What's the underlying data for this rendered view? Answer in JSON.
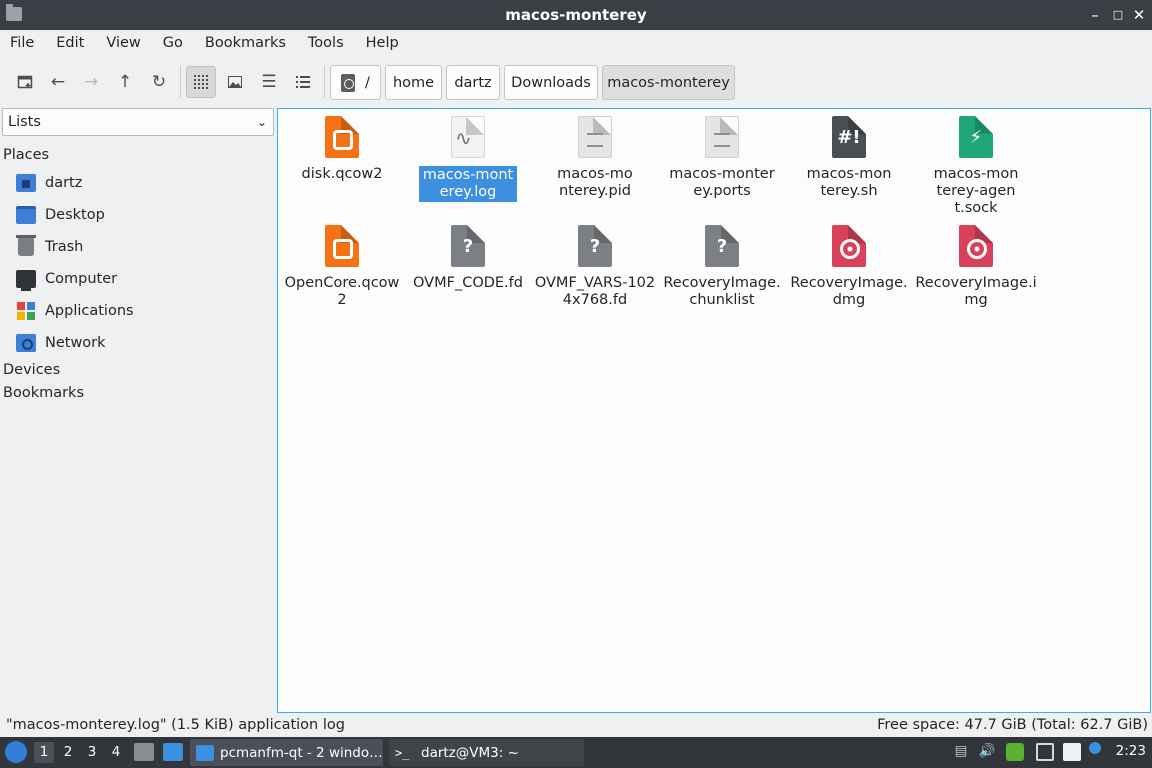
{
  "window": {
    "title": "macos-monterey"
  },
  "menubar": {
    "items": [
      "File",
      "Edit",
      "View",
      "Go",
      "Bookmarks",
      "Tools",
      "Help"
    ]
  },
  "toolbar": {
    "new_window_icon": "new-window-icon",
    "back_icon": "arrow-left-icon",
    "forward_icon": "arrow-right-icon",
    "up_icon": "arrow-up-icon",
    "reload_icon": "reload-icon",
    "view_modes": [
      "icon-view-icon",
      "thumbnail-view-icon",
      "compact-view-icon",
      "detailed-list-view-icon"
    ]
  },
  "breadcrumb": {
    "root_label": "/",
    "segments": [
      "home",
      "dartz",
      "Downloads",
      "macos-monterey"
    ]
  },
  "sidebar": {
    "mode_select": "Lists",
    "places_heading": "Places",
    "places": [
      {
        "label": "dartz",
        "icon": "home-folder-icon"
      },
      {
        "label": "Desktop",
        "icon": "desktop-icon"
      },
      {
        "label": "Trash",
        "icon": "trash-icon"
      },
      {
        "label": "Computer",
        "icon": "computer-icon"
      },
      {
        "label": "Applications",
        "icon": "applications-icon"
      },
      {
        "label": "Network",
        "icon": "network-icon"
      }
    ],
    "devices_heading": "Devices",
    "bookmarks_heading": "Bookmarks"
  },
  "files": [
    {
      "name": "disk.qcow2",
      "icon": "disk-image-icon"
    },
    {
      "name": "macos-monterey.log",
      "icon": "log-file-icon",
      "selected": true
    },
    {
      "name": "macos-monterey.pid",
      "icon": "text-file-icon"
    },
    {
      "name": "macos-monterey.ports",
      "icon": "text-file-icon"
    },
    {
      "name": "macos-monterey.sh",
      "icon": "shell-script-icon"
    },
    {
      "name": "macos-monterey-agent.sock",
      "icon": "socket-file-icon"
    },
    {
      "name": "OpenCore.qcow2",
      "icon": "disk-image-icon"
    },
    {
      "name": "OVMF_CODE.fd",
      "icon": "unknown-file-icon"
    },
    {
      "name": "OVMF_VARS-1024x768.fd",
      "icon": "unknown-file-icon"
    },
    {
      "name": "RecoveryImage.chunklist",
      "icon": "unknown-file-icon"
    },
    {
      "name": "RecoveryImage.dmg",
      "icon": "optical-disc-image-icon"
    },
    {
      "name": "RecoveryImage.img",
      "icon": "optical-disc-image-icon"
    }
  ],
  "statusbar": {
    "selection": "\"macos-monterey.log\" (1.5 KiB) application log",
    "free_space": "Free space: 47.7 GiB (Total: 62.7 GiB)"
  },
  "taskbar": {
    "workspaces": [
      "1",
      "2",
      "3",
      "4"
    ],
    "tasks": [
      {
        "label": "pcmanfm-qt - 2 windo…",
        "icon": "file-manager-icon"
      },
      {
        "label": "dartz@VM3: ~",
        "icon": "terminal-icon"
      }
    ],
    "clock": "2:23"
  }
}
